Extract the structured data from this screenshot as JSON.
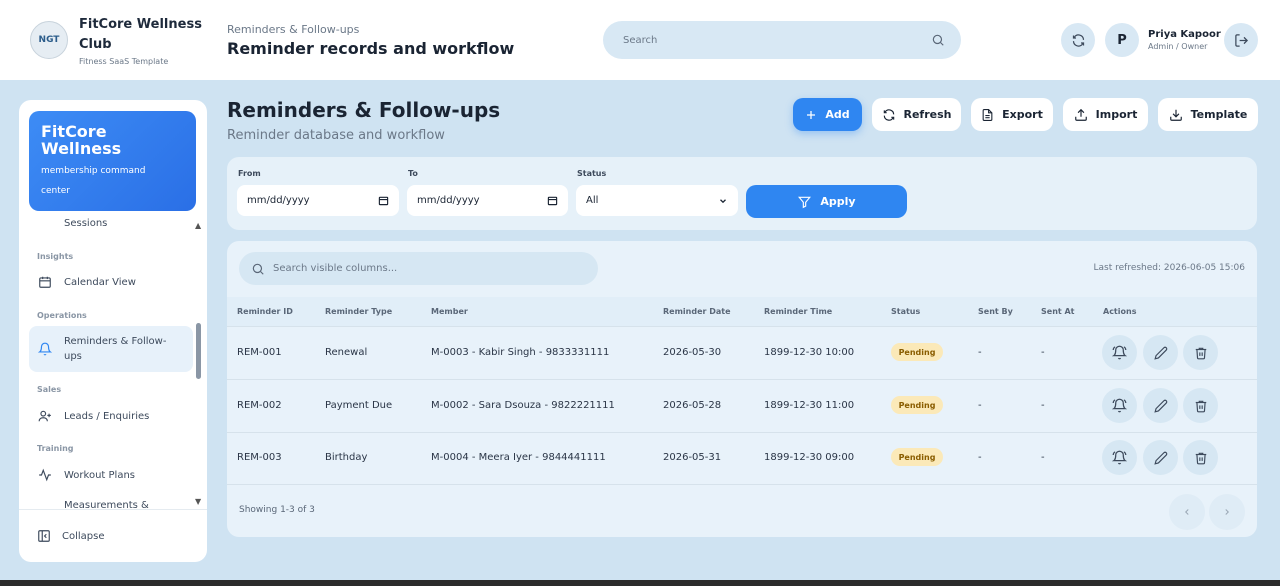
{
  "header": {
    "brand_name": "FitCore Wellness Club",
    "brand_sub": "Fitness SaaS Template",
    "logo_text": "NGT",
    "breadcrumb": "Reminders & Follow-ups",
    "page_title": "Reminder records and workflow",
    "search_placeholder": "Search",
    "user_initial": "P",
    "user_name": "Priya Kapoor",
    "user_role": "Admin / Owner"
  },
  "sidebar": {
    "card_title": "FitCore Wellness",
    "card_sub": "membership command center",
    "sections": {
      "insights": "Insights",
      "operations": "Operations",
      "sales": "Sales",
      "training": "Training"
    },
    "items": {
      "sessions": "Sessions",
      "calendar": "Calendar View",
      "reminders": "Reminders & Follow-ups",
      "leads": "Leads / Enquiries",
      "workout": "Workout Plans",
      "measurements": "Measurements &"
    },
    "collapse": "Collapse"
  },
  "main": {
    "title": "Reminders & Follow-ups",
    "subtitle": "Reminder database and workflow",
    "buttons": {
      "add": "Add",
      "refresh": "Refresh",
      "export": "Export",
      "import": "Import",
      "template": "Template"
    }
  },
  "filters": {
    "from_label": "From",
    "from_value": "mm/dd/yyyy",
    "to_label": "To",
    "to_value": "mm/dd/yyyy",
    "status_label": "Status",
    "status_value": "All",
    "apply": "Apply"
  },
  "table": {
    "search_placeholder": "Search visible columns...",
    "last_refreshed": "Last refreshed: 2026-06-05 15:06",
    "columns": [
      "Reminder ID",
      "Reminder Type",
      "Member",
      "Reminder Date",
      "Reminder Time",
      "Status",
      "Sent By",
      "Sent At",
      "Actions"
    ],
    "rows": [
      {
        "id": "REM-001",
        "type": "Renewal",
        "member": "M-0003 - Kabir Singh - 9833331111",
        "date": "2026-05-30",
        "time": "1899-12-30 10:00",
        "status": "Pending",
        "sent_by": "-",
        "sent_at": "-"
      },
      {
        "id": "REM-002",
        "type": "Payment Due",
        "member": "M-0002 - Sara Dsouza - 9822221111",
        "date": "2026-05-28",
        "time": "1899-12-30 11:00",
        "status": "Pending",
        "sent_by": "-",
        "sent_at": "-"
      },
      {
        "id": "REM-003",
        "type": "Birthday",
        "member": "M-0004 - Meera Iyer - 9844441111",
        "date": "2026-05-31",
        "time": "1899-12-30 09:00",
        "status": "Pending",
        "sent_by": "-",
        "sent_at": "-"
      }
    ],
    "showing": "Showing 1-3 of 3"
  },
  "colors": {
    "accent": "#2f86f1",
    "background": "#cfe3f2",
    "pending_bg": "#fbe9b8"
  }
}
